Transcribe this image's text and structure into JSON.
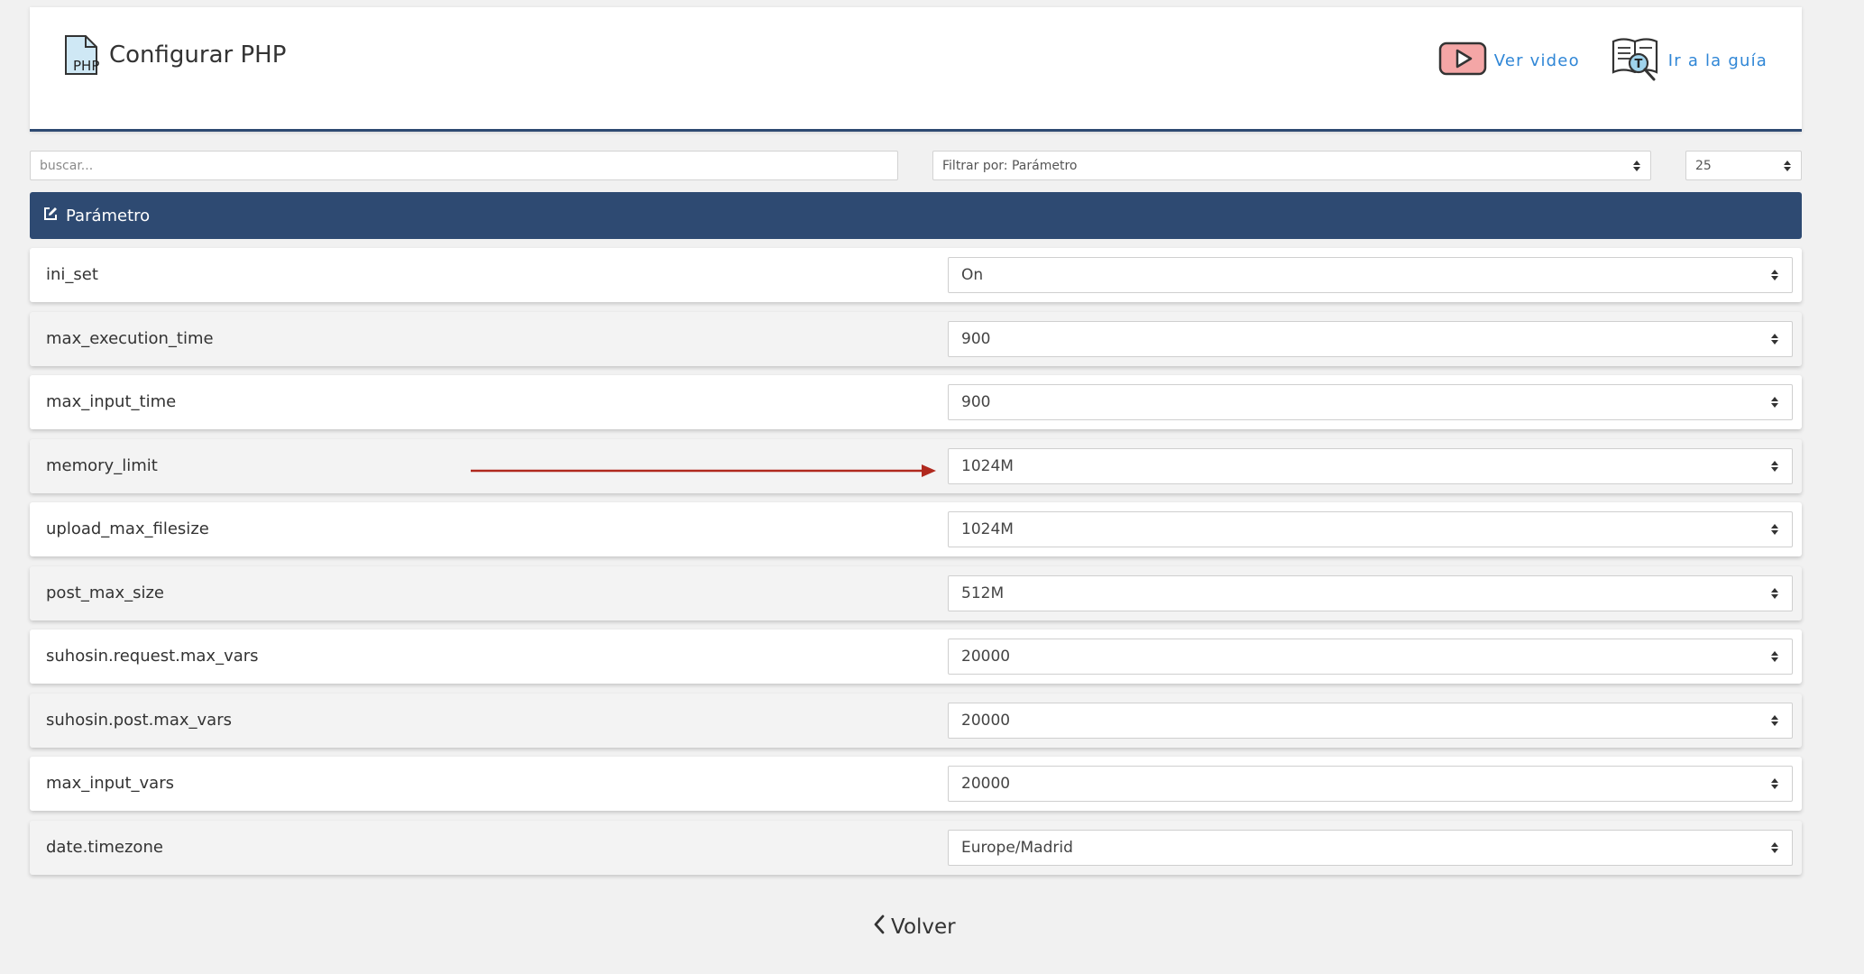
{
  "header": {
    "title": "Configurar PHP",
    "video_label": "Ver video",
    "guide_label": "Ir a la guía",
    "accent_color": "#2e4a72",
    "link_color": "#2f86d6"
  },
  "filters": {
    "search_placeholder": "buscar...",
    "filter_by": "Filtrar por: Parámetro",
    "page_size": "25"
  },
  "table": {
    "column_header": "Parámetro",
    "rows": [
      {
        "name": "ini_set",
        "value": "On"
      },
      {
        "name": "max_execution_time",
        "value": "900"
      },
      {
        "name": "max_input_time",
        "value": "900"
      },
      {
        "name": "memory_limit",
        "value": "1024M"
      },
      {
        "name": "upload_max_filesize",
        "value": "1024M"
      },
      {
        "name": "post_max_size",
        "value": "512M"
      },
      {
        "name": "suhosin.request.max_vars",
        "value": "20000"
      },
      {
        "name": "suhosin.post.max_vars",
        "value": "20000"
      },
      {
        "name": "max_input_vars",
        "value": "20000"
      },
      {
        "name": "date.timezone",
        "value": "Europe/Madrid"
      }
    ]
  },
  "annotation": {
    "arrow_color": "#b0291e",
    "target_row": "memory_limit"
  },
  "footer": {
    "back_label": "Volver"
  }
}
